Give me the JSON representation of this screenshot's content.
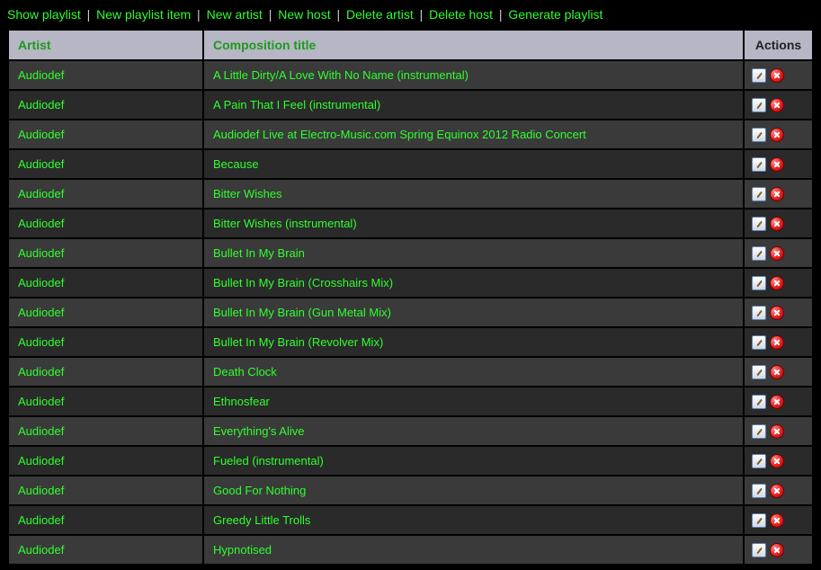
{
  "nav": {
    "items": [
      "Show playlist",
      "New playlist item",
      "New artist",
      "New host",
      "Delete artist",
      "Delete host",
      "Generate playlist"
    ],
    "separator": "|"
  },
  "table": {
    "headers": {
      "artist": "Artist",
      "title": "Composition title",
      "actions": "Actions"
    },
    "rows": [
      {
        "artist": "Audiodef",
        "title": "A Little Dirty/A Love With No Name (instrumental)"
      },
      {
        "artist": "Audiodef",
        "title": "A Pain That I Feel (instrumental)"
      },
      {
        "artist": "Audiodef",
        "title": "Audiodef Live at Electro-Music.com Spring Equinox 2012 Radio Concert"
      },
      {
        "artist": "Audiodef",
        "title": "Because"
      },
      {
        "artist": "Audiodef",
        "title": "Bitter Wishes"
      },
      {
        "artist": "Audiodef",
        "title": "Bitter Wishes (instrumental)"
      },
      {
        "artist": "Audiodef",
        "title": "Bullet In My Brain"
      },
      {
        "artist": "Audiodef",
        "title": "Bullet In My Brain (Crosshairs Mix)"
      },
      {
        "artist": "Audiodef",
        "title": "Bullet In My Brain (Gun Metal Mix)"
      },
      {
        "artist": "Audiodef",
        "title": "Bullet In My Brain (Revolver Mix)"
      },
      {
        "artist": "Audiodef",
        "title": "Death Clock"
      },
      {
        "artist": "Audiodef",
        "title": "Ethnosfear"
      },
      {
        "artist": "Audiodef",
        "title": "Everything's Alive"
      },
      {
        "artist": "Audiodef",
        "title": "Fueled (instrumental)"
      },
      {
        "artist": "Audiodef",
        "title": "Good For Nothing"
      },
      {
        "artist": "Audiodef",
        "title": "Greedy Little Trolls"
      },
      {
        "artist": "Audiodef",
        "title": "Hypnotised"
      }
    ]
  }
}
